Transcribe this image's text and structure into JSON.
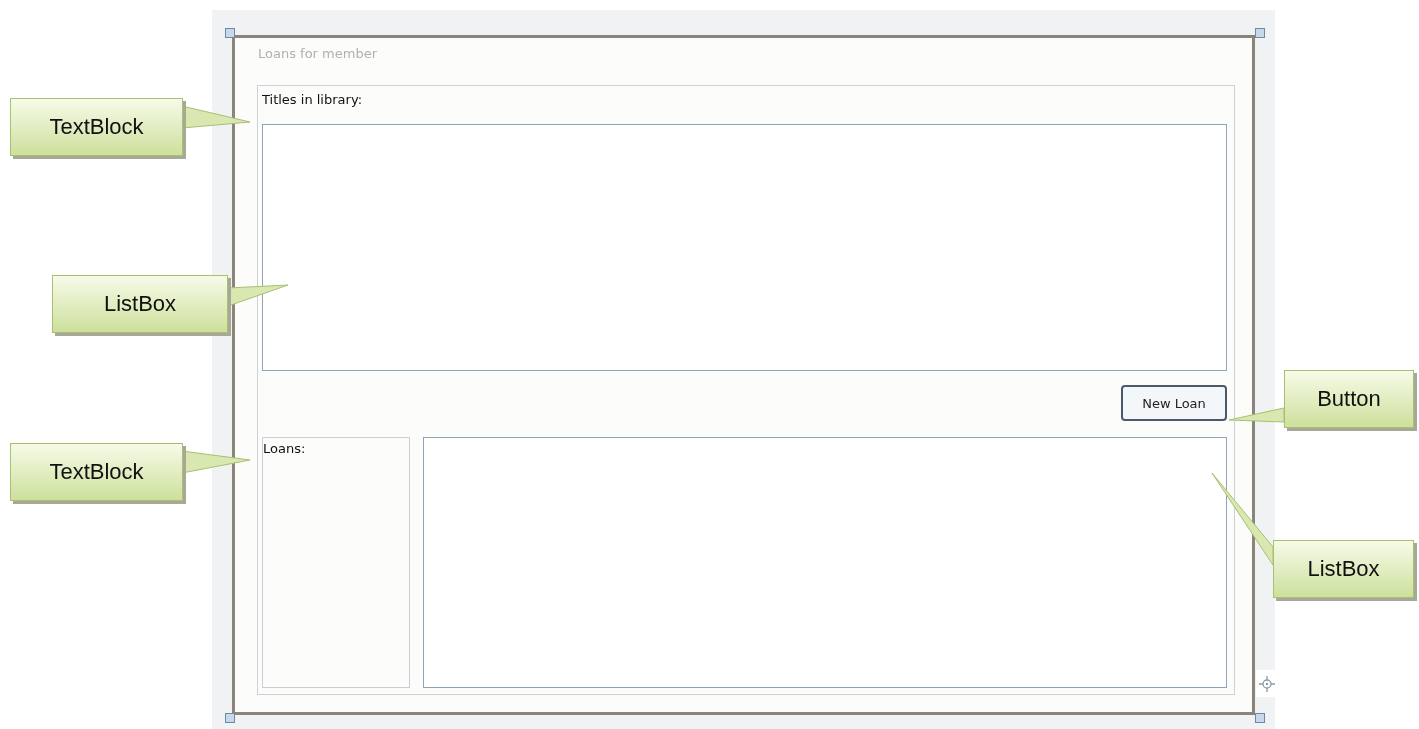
{
  "form": {
    "title": "Loans for member",
    "titles_label": "Titles in library:",
    "new_loan_button": "New Loan",
    "loans_label": "Loans:"
  },
  "callouts": [
    {
      "text": "TextBlock"
    },
    {
      "text": "ListBox"
    },
    {
      "text": "TextBlock"
    },
    {
      "text": "Button"
    },
    {
      "text": "ListBox"
    }
  ]
}
